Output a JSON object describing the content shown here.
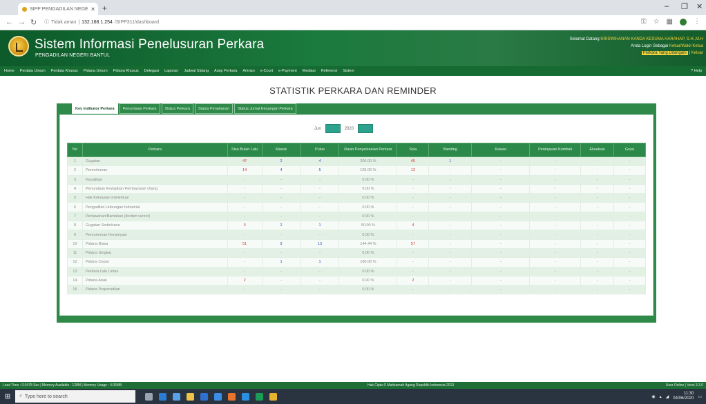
{
  "browser": {
    "tab_title": "SIPP PENGADILAN NEGERI BAN",
    "url_prefix": "Tidak aman",
    "url_host": "132.168.1.254",
    "url_path": "/SIPP311/dashboard"
  },
  "header": {
    "title": "Sistem Informasi Penelusuran Perkara",
    "subtitle": "PENGADILAN NEGERI BANTUL",
    "greeting": "Selamat Datang",
    "user_name": "KRISWIHANAN KANDA KESUMA HARAHAP, S.H.,M.H",
    "login_as_label": "Anda Login Sebagai",
    "login_as_value": "Ketua/Wakil Ketua",
    "agenda_badge": "Perkara Yang Ditangani",
    "exit_label": "Keluar"
  },
  "menu": {
    "items": [
      "Home",
      "Perdata Umum",
      "Perdata Khusus",
      "Pidana Umum",
      "Pidana Khusus",
      "Delegasi",
      "Laporan",
      "Jadwal Sidang",
      "Arsip Perkara",
      "Antrian",
      "e-Court",
      "e-Payment",
      "Mediasi",
      "Referensi",
      "Sistem"
    ],
    "help": "Help"
  },
  "page": {
    "heading": "STATISTIK PERKARA DAN REMINDER"
  },
  "panel": {
    "tabs": [
      "Key Indikator Perkara",
      "Penundaan Perkara",
      "Status Perkara",
      "Status Penahanan",
      "Status Jurnal Keuangan Perkara"
    ],
    "month": "Jun",
    "year": "2020"
  },
  "table": {
    "headers": [
      "No",
      "Perkara",
      "Sisa Bulan Lalu",
      "Masuk",
      "Putus",
      "Rasio Penyelesaian Perkara",
      "Sisa",
      "Banding",
      "Kasasi",
      "Peninjauan Kembali",
      "Eksekusi",
      "Grasi"
    ],
    "rows": [
      [
        "1",
        "Gugatan",
        "47",
        "2",
        "4",
        "200.00 %",
        "45",
        "1",
        "-",
        "-",
        "-",
        "-"
      ],
      [
        "2",
        "Permohonan",
        "14",
        "4",
        "5",
        "125.00 %",
        "13",
        "-",
        "-",
        "-",
        "-",
        "-"
      ],
      [
        "3",
        "Kepailitan",
        "-",
        "-",
        "-",
        "0.00 %",
        "-",
        "-",
        "-",
        "-",
        "-",
        "-"
      ],
      [
        "4",
        "Penundaan Kewajiban Pembayaran Utang",
        "-",
        "-",
        "-",
        "0.00 %",
        "-",
        "-",
        "-",
        "-",
        "-",
        "-"
      ],
      [
        "5",
        "Hak Kekayaan Intelektual",
        "-",
        "-",
        "-",
        "0.00 %",
        "-",
        "-",
        "-",
        "-",
        "-",
        "-"
      ],
      [
        "6",
        "Pengadilan Hubungan Industrial",
        "-",
        "-",
        "-",
        "0.00 %",
        "-",
        "-",
        "-",
        "-",
        "-",
        "-"
      ],
      [
        "7",
        "Perlawanan/Bantahan (derden verzet)",
        "-",
        "-",
        "-",
        "0.00 %",
        "-",
        "-",
        "-",
        "-",
        "-",
        "-"
      ],
      [
        "8",
        "Gugatan Sederhana",
        "3",
        "2",
        "1",
        "50.00 %",
        "4",
        "-",
        "-",
        "-",
        "-",
        "-"
      ],
      [
        "9",
        "Permohonan Konsinyasi",
        "-",
        "-",
        "-",
        "0.00 %",
        "-",
        "-",
        "-",
        "-",
        "-",
        "-"
      ],
      [
        "10",
        "Pidana Biasa",
        "51",
        "9",
        "13",
        "144.44 %",
        "57",
        "-",
        "-",
        "-",
        "-",
        "-"
      ],
      [
        "11",
        "Pidana Singkat",
        "-",
        "-",
        "-",
        "0.00 %",
        "-",
        "-",
        "-",
        "-",
        "-",
        "-"
      ],
      [
        "12",
        "Pidana Cepat",
        "-",
        "1",
        "1",
        "100.00 %",
        "-",
        "-",
        "-",
        "-",
        "-",
        "-"
      ],
      [
        "13",
        "Perkara Lalu Lintas",
        "-",
        "-",
        "-",
        "0.00 %",
        "-",
        "-",
        "-",
        "-",
        "-",
        "-"
      ],
      [
        "14",
        "Pidana Anak",
        "2",
        "-",
        "-",
        "0.00 %",
        "2",
        "-",
        "-",
        "-",
        "-",
        "-"
      ],
      [
        "15",
        "Pidana Praperadilan",
        "-",
        "-",
        "-",
        "0.00 %",
        "-",
        "-",
        "-",
        "-",
        "-",
        "-"
      ]
    ]
  },
  "statusbar": {
    "left": "Load Time : 0.0478 Sec | Memory Available : 128M | Memory Usage : 4.06MB",
    "center": "Hak Cipta © Mahkamah Agung Republik Indonesia 2013",
    "right": "User Online | Versi 3.3.0"
  },
  "taskbar": {
    "search_placeholder": "Type here to search",
    "time": "11:30",
    "date": "04/06/2020"
  },
  "colors": {
    "header_green": "#1b7a3d",
    "menu_green": "#166b32",
    "panel_green": "#2f8a4a",
    "accent_yellow": "#f5d13b",
    "value_red": "#d23030",
    "value_blue": "#2a4fc9"
  }
}
